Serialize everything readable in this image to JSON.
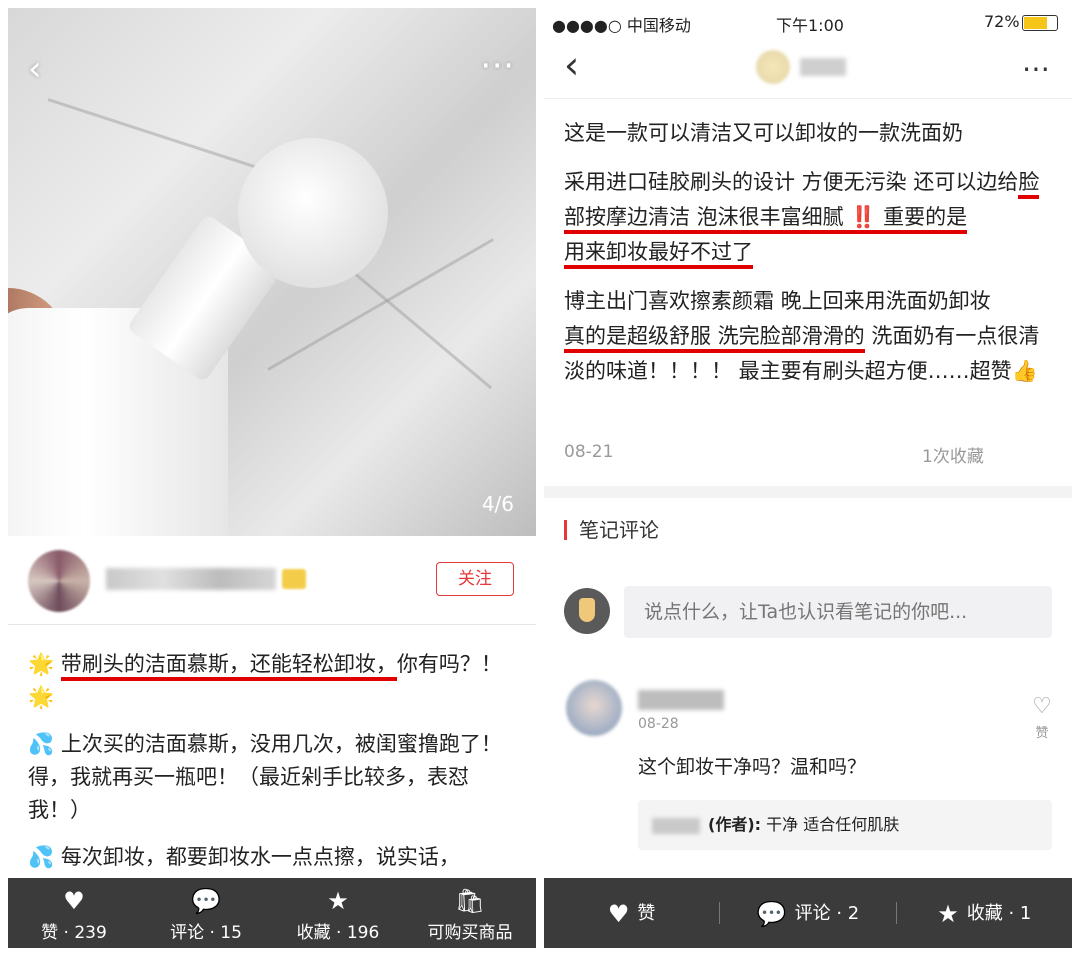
{
  "left": {
    "photo": {
      "counter": "4/6",
      "more_icon": "⋯"
    },
    "author": {
      "follow_label": "关注"
    },
    "note": {
      "p1_pre": "🌟 ",
      "p1_underlined": "带刷头的洁面慕斯，还能轻松卸妆，",
      "p1_post": "你有吗？！ 🌟",
      "p2": "💦 上次买的洁面慕斯，没用几次，被闺蜜撸跑了！得，我就再买一瓶吧！（最近剁手比较多，表怼我！）",
      "p3": "💦 每次卸妆，都要卸妆水一点点擦，说实话，"
    },
    "bottom_bar": [
      {
        "icon": "heart-icon",
        "label": "赞 · 239"
      },
      {
        "icon": "comment-icon",
        "label": "评论 · 15"
      },
      {
        "icon": "star-icon",
        "label": "收藏 · 196"
      },
      {
        "icon": "bag-icon",
        "label": "可购买商品"
      }
    ]
  },
  "right": {
    "status": {
      "carrier": "●●●●○ 中国移动",
      "time": "下午1:00",
      "battery": "72%"
    },
    "note": {
      "p1": "这是一款可以清洁又可以卸妆的一款洗面奶",
      "p2_a": "采用进口硅胶刷头的设计 方便无污染 还可以边给",
      "p2_u1": "脸部按摩边清洁 泡沫很丰富细腻 ‼️ 重要的是",
      "p2_u2": "用来卸妆最好不过了",
      "p3_a": "博主出门喜欢擦素颜霜 晚上回来用洗面奶卸妆",
      "p3_u": "真的是超级舒服 洗完脸部滑滑的",
      "p3_b": " 洗面奶有一点很清淡的味道！！！！ 最主要有刷头超方便……超赞👍"
    },
    "meta": {
      "date": "08-21",
      "saves": "1次收藏"
    },
    "comments": {
      "section_title": "笔记评论",
      "input_placeholder": "说点什么，让Ta也认识看笔记的你吧...",
      "items": [
        {
          "date": "08-28",
          "text": "这个卸妆干净吗？温和吗？",
          "like_label": "赞",
          "reply": {
            "author_tag": "(作者):",
            "text": "干净 适合任何肌肤"
          }
        }
      ]
    },
    "bottom_bar": [
      {
        "icon": "heart-icon",
        "label": "赞"
      },
      {
        "icon": "comment-icon",
        "label": "评论 · 2"
      },
      {
        "icon": "star-icon",
        "label": "收藏 · 1"
      }
    ]
  }
}
